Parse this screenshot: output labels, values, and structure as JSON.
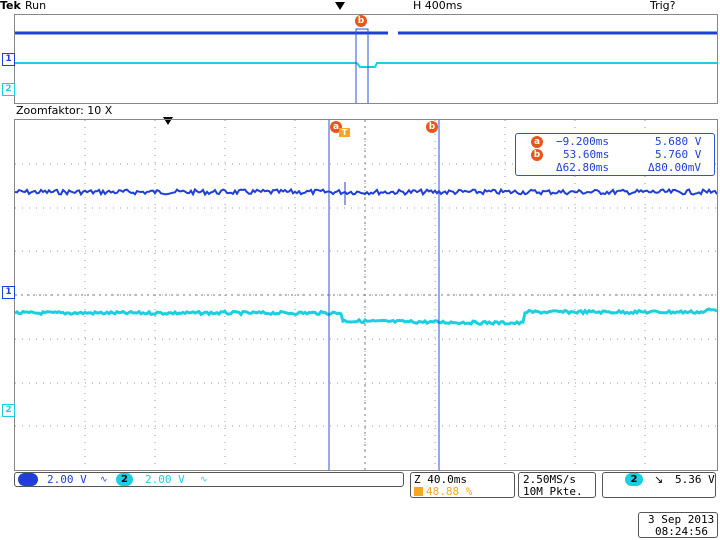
{
  "header": {
    "brand": "Tek",
    "mode": "Run",
    "horizontal": "H 400ms",
    "trigger_state": "Trig?"
  },
  "zoom": {
    "label": "Zoomfaktor: 10 X"
  },
  "cursor_readout": {
    "a_time": "−9.200ms",
    "a_volt": "5.680 V",
    "b_time": "53.60ms",
    "b_volt": "5.760 V",
    "delta_time": "Δ62.80ms",
    "delta_volt": "Δ80.00mV",
    "a_label": "a",
    "b_label": "b"
  },
  "channels": [
    {
      "id": "1",
      "scale": "2.00 V",
      "coupling": "∿",
      "color": "#1f3fd6"
    },
    {
      "id": "2",
      "scale": "2.00 V",
      "coupling": "∿",
      "color": "#1ad0e0"
    }
  ],
  "timebase": {
    "zoom_scale": "Z 40.0ms",
    "position": "48.88 %"
  },
  "acquisition": {
    "sample_rate": "2.50MS/s",
    "record_length": "10M Pkte."
  },
  "trigger": {
    "channel": "2",
    "slope": "↘",
    "level": "5.36 V"
  },
  "datetime": {
    "date": "3 Sep  2013",
    "time": "08:24:56"
  },
  "markers": {
    "a": "a",
    "b": "b",
    "trig": "T",
    "ch1": "1",
    "ch2": "2"
  },
  "colors": {
    "ch1": "#1f3fd6",
    "ch2": "#1ad0e0",
    "marker": "#e8561a",
    "grid": "#9a9a9a"
  }
}
